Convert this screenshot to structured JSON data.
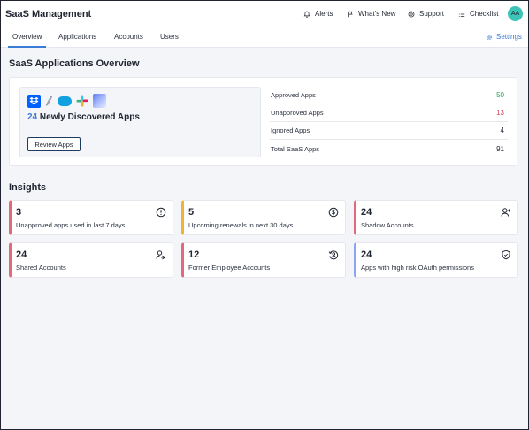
{
  "header": {
    "title": "SaaS Management",
    "nav": [
      {
        "label": "Alerts",
        "icon": "bell-icon"
      },
      {
        "label": "What's New",
        "icon": "flag-icon"
      },
      {
        "label": "Support",
        "icon": "support-icon"
      },
      {
        "label": "Checklist",
        "icon": "checklist-icon"
      }
    ],
    "avatar_initials": "AA"
  },
  "tabs": [
    {
      "label": "Overview",
      "active": true
    },
    {
      "label": "Applications",
      "active": false
    },
    {
      "label": "Accounts",
      "active": false
    },
    {
      "label": "Users",
      "active": false
    }
  ],
  "settings_label": "Settings",
  "overview": {
    "title": "SaaS Applications Overview",
    "discovered_count": "24",
    "discovered_text": "Newly Discovered Apps",
    "review_button": "Review Apps",
    "app_logos": [
      "dropbox-logo",
      "pen-logo",
      "salesforce-logo",
      "slack-logo",
      "gradient-app-logo"
    ],
    "stats": [
      {
        "label": "Approved Apps",
        "value": "50",
        "color": "#2e9e5b"
      },
      {
        "label": "Unapproved Apps",
        "value": "13",
        "color": "#d6455d"
      },
      {
        "label": "Ignored Apps",
        "value": "4",
        "color": "#2b3140"
      },
      {
        "label": "Total SaaS Apps",
        "value": "91",
        "color": "#1f2430"
      }
    ]
  },
  "insights": {
    "title": "Insights",
    "cards": [
      {
        "value": "3",
        "label": "Unapproved apps used in last 7 days",
        "accent": "#e06a79",
        "icon": "alert-circle-icon"
      },
      {
        "value": "5",
        "label": "Upcoming renewals in next 30 days",
        "accent": "#f2b233",
        "icon": "dollar-circle-icon"
      },
      {
        "value": "24",
        "label": "Shadow Accounts",
        "accent": "#e06a79",
        "icon": "user-plus-icon"
      },
      {
        "value": "24",
        "label": "Shared Accounts",
        "accent": "#e06a79",
        "icon": "user-shared-icon"
      },
      {
        "value": "12",
        "label": "Former Employee Accounts",
        "accent": "#e06a79",
        "icon": "user-history-icon"
      },
      {
        "value": "24",
        "label": "Apps with high risk OAuth permissions",
        "accent": "#8aa6f0",
        "icon": "shield-check-icon"
      }
    ]
  }
}
